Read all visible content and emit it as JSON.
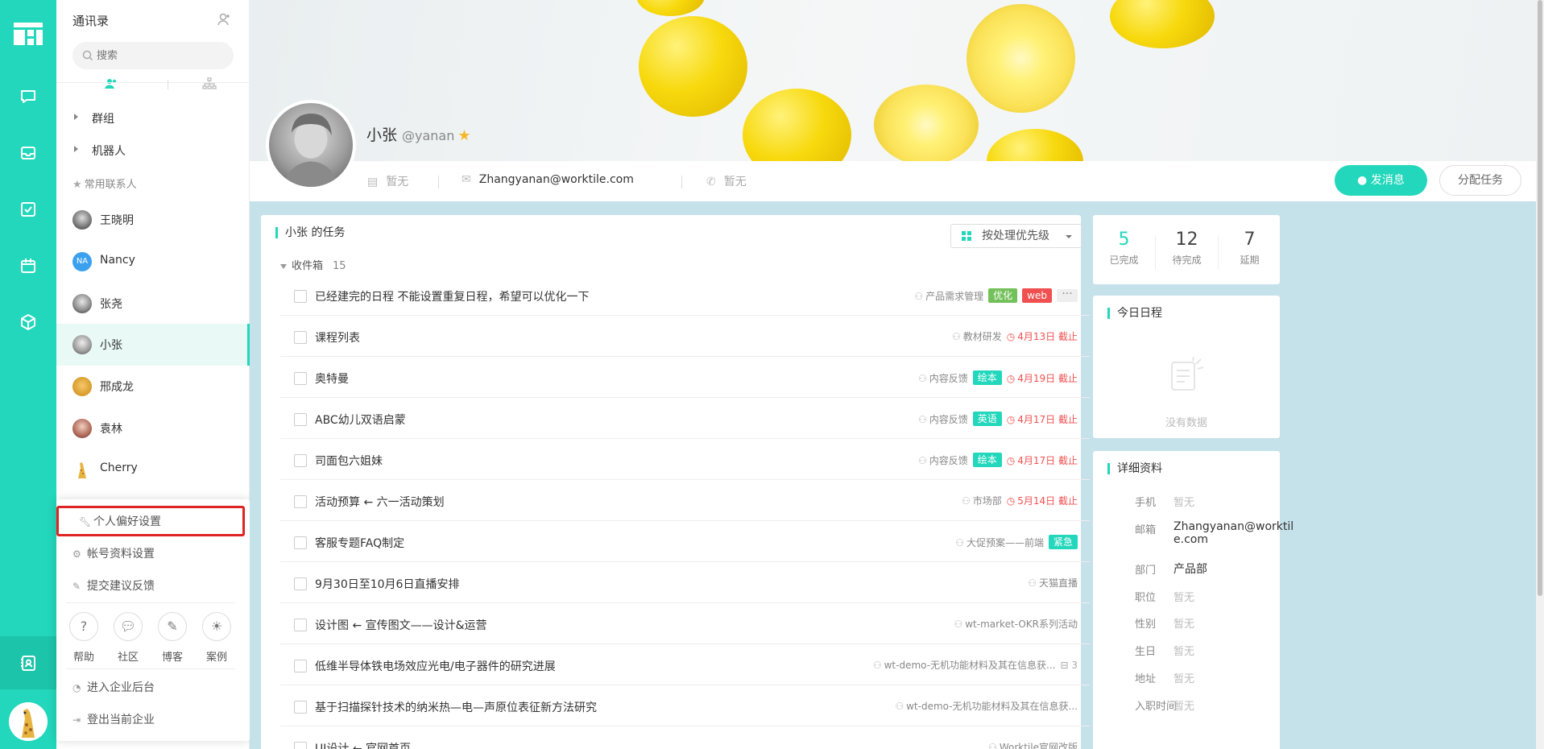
{
  "contacts_panel": {
    "title": "通讯录",
    "search_placeholder": "搜索",
    "groups": [
      "群组",
      "机器人"
    ],
    "favorites_header": "常用联系人",
    "contacts": [
      {
        "name": "王晓明",
        "avatar": "photo"
      },
      {
        "name": "Nancy",
        "avatar": "NA"
      },
      {
        "name": "张尧",
        "avatar": "photo"
      },
      {
        "name": "小张",
        "avatar": "photo",
        "active": true
      },
      {
        "name": "邢成龙",
        "avatar": "dog"
      },
      {
        "name": "袁林",
        "avatar": "photo"
      },
      {
        "name": "Cherry",
        "avatar": "giraffe"
      }
    ]
  },
  "popup_menu": {
    "items_top": [
      "个人偏好设置",
      "帐号资料设置",
      "提交建议反馈"
    ],
    "circles": [
      "帮助",
      "社区",
      "博客",
      "案例"
    ],
    "items_bottom": [
      "进入企业后台",
      "登出当前企业"
    ]
  },
  "profile": {
    "name": "小张",
    "handle": "@yanan",
    "id_card": "暂无",
    "email": "Zhangyanan@worktile.com",
    "phone": "暂无",
    "send_message": "发消息",
    "assign_task": "分配任务"
  },
  "tasks": {
    "title": "小张 的任务",
    "sort_label": "按处理优先级",
    "inbox_label": "收件箱",
    "inbox_count": "15",
    "rows": [
      {
        "title": "已经建完的日程 不能设置重复日程，希望可以优化一下",
        "project": "产品需求管理",
        "tags": [
          {
            "text": "优化",
            "color": "#73c15a"
          },
          {
            "text": "web",
            "color": "#f05050"
          }
        ],
        "due": "",
        "more": true
      },
      {
        "title": "课程列表",
        "project": "教材研发",
        "tags": [],
        "due": "4月13日 截止"
      },
      {
        "title": "奥特曼",
        "project": "内容反馈",
        "tags": [
          {
            "text": "绘本",
            "color": "#22d7bb"
          }
        ],
        "due": "4月19日 截止"
      },
      {
        "title": "ABC幼儿双语启蒙",
        "project": "内容反馈",
        "tags": [
          {
            "text": "英语",
            "color": "#22d7bb"
          }
        ],
        "due": "4月17日 截止"
      },
      {
        "title": "司面包六姐妹",
        "project": "内容反馈",
        "tags": [
          {
            "text": "绘本",
            "color": "#22d7bb"
          }
        ],
        "due": "4月17日 截止"
      },
      {
        "title": "活动预算 ← 六一活动策划",
        "project": "市场部",
        "tags": [],
        "due": "5月14日 截止"
      },
      {
        "title": "客服专题FAQ制定",
        "project": "大促预案——前端",
        "tags": [
          {
            "text": "紧急",
            "color": "#22d7bb"
          }
        ],
        "due": ""
      },
      {
        "title": "9月30日至10月6日直播安排",
        "project": "天猫直播",
        "tags": [],
        "due": ""
      },
      {
        "title": "设计图 ← 宣传图文——设计&运营",
        "project": "wt-market-OKR系列活动",
        "tags": [],
        "due": ""
      },
      {
        "title": "低维半导体铁电场效应光电/电子器件的研究进展",
        "project": "wt-demo-无机功能材料及其在信息获...",
        "tags": [],
        "due": "",
        "subtasks": "3"
      },
      {
        "title": "基于扫描探针技术的纳米热—电—声原位表征新方法研究",
        "project": "wt-demo-无机功能材料及其在信息获...",
        "tags": [],
        "due": ""
      },
      {
        "title": "UI设计 ← 官网首页",
        "project": "Worktile官网改版",
        "tags": [],
        "due": ""
      }
    ]
  },
  "stats": [
    {
      "value": "5",
      "label": "已完成"
    },
    {
      "value": "12",
      "label": "待完成"
    },
    {
      "value": "7",
      "label": "延期"
    }
  ],
  "schedule": {
    "title": "今日日程",
    "empty": "没有数据"
  },
  "details": {
    "title": "详细资料",
    "fields": [
      {
        "label": "手机",
        "value": "暂无"
      },
      {
        "label": "邮箱",
        "value": "Zhangyanan@worktile.com"
      },
      {
        "label": "部门",
        "value": "产品部"
      },
      {
        "label": "职位",
        "value": "暂无"
      },
      {
        "label": "性别",
        "value": "暂无"
      },
      {
        "label": "生日",
        "value": "暂无"
      },
      {
        "label": "地址",
        "value": "暂无"
      },
      {
        "label": "入职时间",
        "value": "暂无"
      }
    ]
  },
  "colors": {
    "accent": "#22d7bb",
    "danger": "#f05050",
    "highlight_box": "#e02424"
  }
}
